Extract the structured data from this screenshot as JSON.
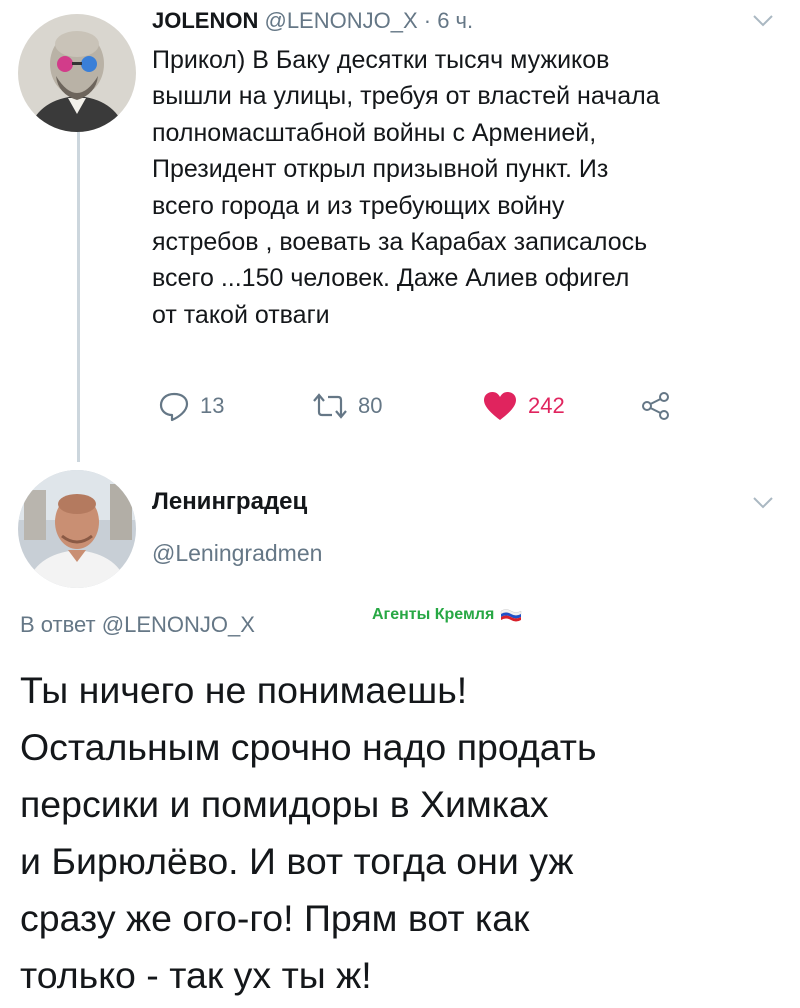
{
  "tweet": {
    "author_name": "JOLENON",
    "author_handle": "@LENONJO_X",
    "separator": " · ",
    "time": "6 ч.",
    "text_lines": [
      "Прикол) В Баку десятки тысяч мужиков",
      "вышли на улицы, требуя от властей начала",
      "полномасштабной войны с Арменией,",
      "Президент открыл призывной пункт. Из",
      "всего города и из требующих войну",
      "ястребов , воевать за Карабах записалось",
      "всего ...150 человек. Даже Алиев офигел",
      "от такой отваги"
    ],
    "actions": {
      "replies": "13",
      "retweets": "80",
      "likes": "242"
    },
    "icons": {
      "reply": "reply-icon",
      "retweet": "retweet-icon",
      "like": "heart-icon",
      "share": "share-icon"
    },
    "like_color": "#e0245e"
  },
  "reply": {
    "author_name": "Ленинградец",
    "author_handle": "@Leningradmen",
    "reply_to_prefix": "В ответ ",
    "reply_to_handle": "@LENONJO_X",
    "badge_text": "Агенты Кремля",
    "badge_color": "#27a844",
    "text_lines": [
      "Ты ничего не понимаешь!",
      "Остальным срочно надо продать",
      "персики и помидоры в Химках",
      "и Бирюлёво. И вот тогда они уж",
      "сразу же ого-го! Прям вот как",
      "только - так ух ты ж!"
    ]
  }
}
